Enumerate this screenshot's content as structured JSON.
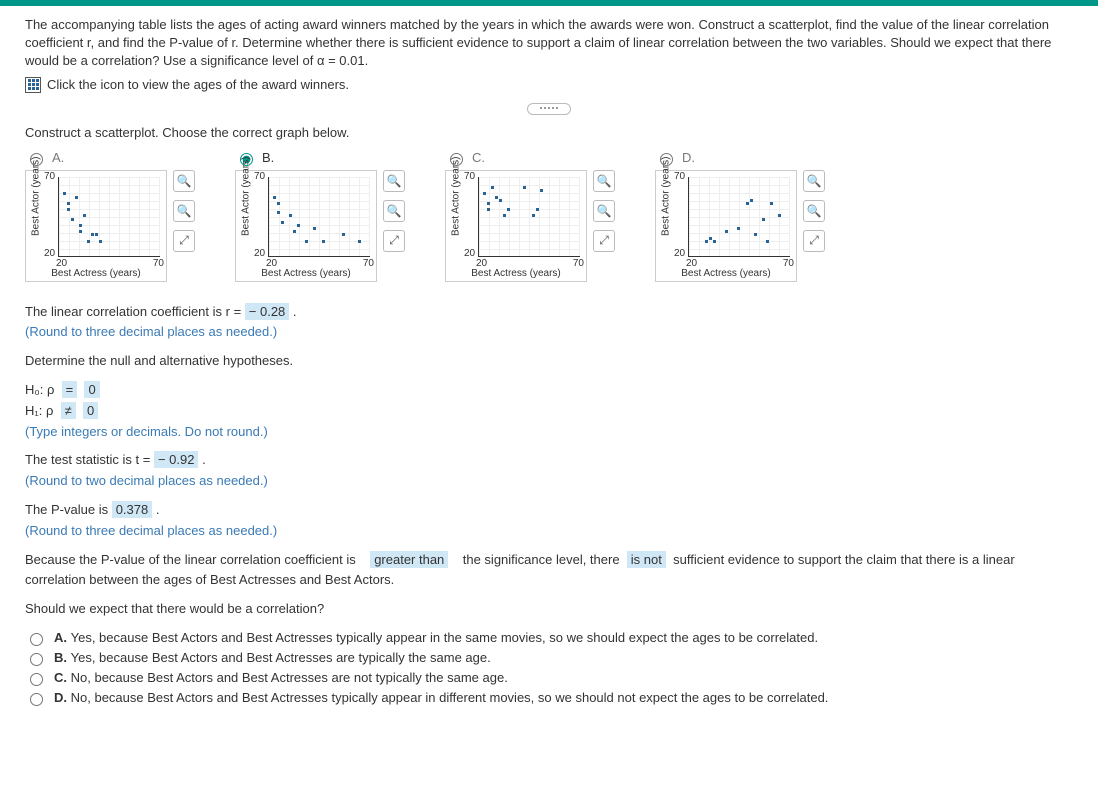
{
  "intro": "The accompanying table lists the ages of acting award winners matched by the years in which the awards were won. Construct a scatterplot, find the value of the linear correlation coefficient r, and find the P-value of r. Determine whether there is sufficient evidence to support a claim of linear correlation between the two variables. Should we expect that there would be a correlation? Use a significance level of α = 0.01.",
  "icon_link_text": "Click the icon to view the ages of the award winners.",
  "prompt": "Construct a scatterplot. Choose the correct graph below.",
  "options": {
    "A": "A.",
    "B": "B.",
    "C": "C.",
    "D": "D."
  },
  "chart": {
    "ylabel": "Best Actor (years)",
    "xlabel": "Best Actress (years)",
    "y_top": "70",
    "y_bot": "20",
    "x_left": "20",
    "x_right": "70"
  },
  "chart_data": [
    {
      "type": "scatter",
      "option": "A",
      "xlabel": "Best Actress (years)",
      "ylabel": "Best Actor (years)",
      "xlim": [
        20,
        70
      ],
      "ylim": [
        20,
        70
      ],
      "points": [
        [
          22,
          60
        ],
        [
          24,
          54
        ],
        [
          24,
          50
        ],
        [
          26,
          44
        ],
        [
          28,
          58
        ],
        [
          30,
          40
        ],
        [
          30,
          36
        ],
        [
          32,
          46
        ],
        [
          34,
          30
        ],
        [
          36,
          34
        ],
        [
          38,
          34
        ],
        [
          40,
          30
        ]
      ]
    },
    {
      "type": "scatter",
      "option": "B",
      "xlabel": "Best Actress (years)",
      "ylabel": "Best Actor (years)",
      "xlim": [
        20,
        70
      ],
      "ylim": [
        20,
        70
      ],
      "points": [
        [
          22,
          58
        ],
        [
          24,
          54
        ],
        [
          24,
          48
        ],
        [
          26,
          42
        ],
        [
          30,
          46
        ],
        [
          32,
          36
        ],
        [
          34,
          40
        ],
        [
          38,
          30
        ],
        [
          42,
          38
        ],
        [
          46,
          30
        ],
        [
          56,
          34
        ],
        [
          64,
          30
        ]
      ]
    },
    {
      "type": "scatter",
      "option": "C",
      "xlabel": "Best Actress (years)",
      "ylabel": "Best Actor (years)",
      "xlim": [
        20,
        70
      ],
      "ylim": [
        20,
        70
      ],
      "points": [
        [
          22,
          60
        ],
        [
          24,
          54
        ],
        [
          24,
          50
        ],
        [
          26,
          64
        ],
        [
          28,
          58
        ],
        [
          30,
          56
        ],
        [
          32,
          46
        ],
        [
          34,
          50
        ],
        [
          42,
          64
        ],
        [
          46,
          46
        ],
        [
          48,
          50
        ],
        [
          50,
          62
        ]
      ]
    },
    {
      "type": "scatter",
      "option": "D",
      "xlabel": "Best Actress (years)",
      "ylabel": "Best Actor (years)",
      "xlim": [
        20,
        70
      ],
      "ylim": [
        20,
        70
      ],
      "points": [
        [
          28,
          30
        ],
        [
          30,
          32
        ],
        [
          32,
          30
        ],
        [
          38,
          36
        ],
        [
          44,
          38
        ],
        [
          48,
          54
        ],
        [
          50,
          56
        ],
        [
          52,
          34
        ],
        [
          56,
          44
        ],
        [
          58,
          30
        ],
        [
          60,
          54
        ],
        [
          64,
          46
        ]
      ]
    }
  ],
  "corr_line_pre": "The linear correlation coefficient is r = ",
  "corr_value": "− 0.28",
  "corr_hint": "(Round to three decimal places as needed.)",
  "hyp_intro": "Determine the null and alternative hypotheses.",
  "h0_label": "H₀: ρ",
  "h0_op": "=",
  "h0_val": "0",
  "h1_label": "H₁: ρ",
  "h1_op": "≠",
  "h1_val": "0",
  "hyp_hint": "(Type integers or decimals. Do not round.)",
  "t_line_pre": "The test statistic is t = ",
  "t_value": "− 0.92",
  "t_hint": "(Round to two decimal places as needed.)",
  "p_line_pre": "The P-value is ",
  "p_value": "0.378",
  "p_hint": "(Round to three decimal places as needed.)",
  "concl_1": "Because the P-value of the linear correlation coefficient is",
  "concl_drop1": "greater than",
  "concl_2": "the significance level, there",
  "concl_drop2": "is not",
  "concl_3": "sufficient evidence to support the claim that there is a linear correlation between the ages of Best Actresses and Best Actors.",
  "expect_q": "Should we expect that there would be a correlation?",
  "final": {
    "A": "Yes, because Best Actors and Best Actresses typically appear in the same movies, so we should expect the ages to be correlated.",
    "B": "Yes, because Best Actors and Best Actresses are typically the same age.",
    "C": "No, because Best Actors and Best Actresses are not typically the same age.",
    "D": "No, because Best Actors and Best Actresses typically appear in different movies, so we should not expect the ages to be correlated."
  },
  "final_labels": {
    "A": "A.",
    "B": "B.",
    "C": "C.",
    "D": "D."
  }
}
